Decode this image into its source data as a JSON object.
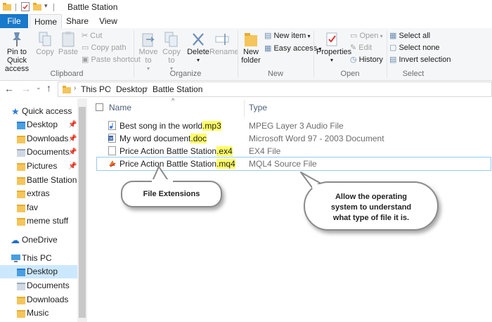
{
  "window": {
    "title": "Battle Station"
  },
  "tabs": [
    {
      "label": "File"
    },
    {
      "label": "Home"
    },
    {
      "label": "Share"
    },
    {
      "label": "View"
    }
  ],
  "ribbon": {
    "clipboard": {
      "label": "Clipboard",
      "pin_quick_access": "Pin to Quick access",
      "copy": "Copy",
      "paste": "Paste",
      "cut": "Cut",
      "copy_path": "Copy path",
      "paste_shortcut": "Paste shortcut"
    },
    "organize": {
      "label": "Organize",
      "move_to": "Move to",
      "copy_to": "Copy to",
      "delete": "Delete",
      "rename": "Rename"
    },
    "new": {
      "label": "New",
      "new_folder": "New folder",
      "new_item": "New item",
      "easy_access": "Easy access"
    },
    "open": {
      "label": "Open",
      "properties": "Properties",
      "open": "Open",
      "edit": "Edit",
      "history": "History"
    },
    "select": {
      "label": "Select",
      "select_all": "Select all",
      "select_none": "Select none",
      "invert_selection": "Invert selection"
    }
  },
  "breadcrumb": [
    "This PC",
    "Desktop",
    "Battle Station"
  ],
  "sidebar": {
    "quick_access": "Quick access",
    "quick_items": [
      {
        "label": "Desktop",
        "pinned": true
      },
      {
        "label": "Downloads",
        "pinned": true
      },
      {
        "label": "Documents",
        "pinned": true
      },
      {
        "label": "Pictures",
        "pinned": true
      },
      {
        "label": "Battle Station",
        "pinned": false
      },
      {
        "label": "extras",
        "pinned": false
      },
      {
        "label": "fav",
        "pinned": false
      },
      {
        "label": "meme stuff",
        "pinned": false
      }
    ],
    "onedrive": "OneDrive",
    "this_pc": "This PC",
    "pc_items": [
      {
        "label": "Desktop"
      },
      {
        "label": "Documents"
      },
      {
        "label": "Downloads"
      },
      {
        "label": "Music"
      }
    ]
  },
  "columns": {
    "name": "Name",
    "type": "Type"
  },
  "files": [
    {
      "base": "Best song in the world",
      "ext": ".mp3",
      "type": "MPEG Layer 3 Audio File",
      "icon": "audio-file-icon"
    },
    {
      "base": "My word document",
      "ext": ".doc",
      "type": "Microsoft Word 97 - 2003 Document",
      "icon": "word-file-icon"
    },
    {
      "base": "Price Action Battle Station",
      "ext": ".ex4",
      "type": "EX4 File",
      "icon": "generic-file-icon"
    },
    {
      "base": "Price Action Battle Station",
      "ext": ".mq4",
      "type": "MQL4 Source File",
      "icon": "mql4-file-icon"
    }
  ],
  "callouts": {
    "extensions": "File Extensions",
    "explanation": "Allow the operating system to understand what type of file it is."
  },
  "colors": {
    "accent": "#1979ca",
    "highlight": "#ffff66",
    "selection": "#cce8ff"
  }
}
